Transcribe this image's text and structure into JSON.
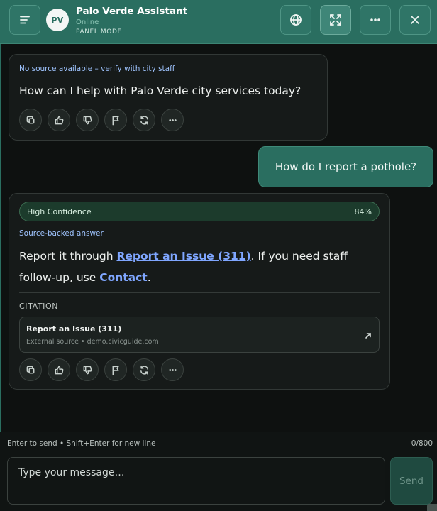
{
  "header": {
    "avatar_initials": "PV",
    "title": "Palo Verde Assistant",
    "status": "Online",
    "mode": "PANEL MODE",
    "buttons": [
      {
        "name": "menu",
        "icon": "menu-icon"
      },
      {
        "name": "language",
        "icon": "globe-icon"
      },
      {
        "name": "expand",
        "icon": "expand-icon",
        "active": true
      },
      {
        "name": "more",
        "icon": "more-horizontal-icon"
      },
      {
        "name": "close",
        "icon": "close-icon"
      }
    ],
    "accent_color": "#2a6e60"
  },
  "messages": {
    "welcome": {
      "source_note": "No source available – verify with city staff",
      "text": "How can I help with Palo Verde city services today?"
    },
    "user": {
      "text": "How do I report a pothole?"
    },
    "answer": {
      "confidence_label": "High Confidence",
      "confidence_pct": "84%",
      "source_note": "Source-backed answer",
      "text_before": "Report it through ",
      "link1": "Report an Issue (311)",
      "text_mid": ". If you need staff follow-up, use ",
      "link2": "Contact",
      "text_after": ".",
      "citation_label": "CITATION",
      "citation_title": "Report an Issue (311)",
      "citation_sub": "External source • demo.civicguide.com"
    },
    "action_icons": [
      "copy-icon",
      "thumbs-up-icon",
      "thumbs-down-icon",
      "flag-icon",
      "refresh-icon",
      "more-horizontal-icon"
    ]
  },
  "composer": {
    "hint": "Enter to send • Shift+Enter for new line",
    "count": "0/800",
    "placeholder": "Type your message…",
    "value": "",
    "send_label": "Send"
  }
}
